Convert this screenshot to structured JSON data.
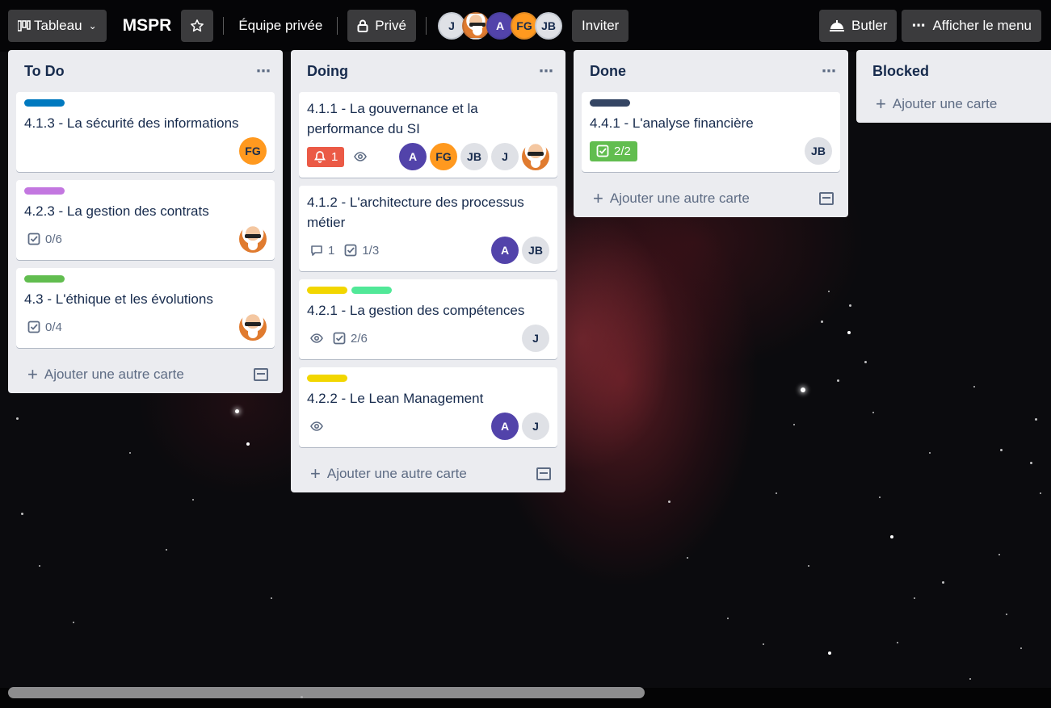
{
  "topbar": {
    "board_switcher": "Tableau",
    "board_title": "MSPR",
    "team": "Équipe privée",
    "visibility": "Privé",
    "members": [
      "J",
      "photo",
      "A",
      "FG",
      "JB"
    ],
    "invite": "Inviter",
    "butler": "Butler",
    "show_menu": "Afficher le menu"
  },
  "lists": [
    {
      "title": "To Do",
      "add_card": "Ajouter une autre carte",
      "cards": [
        {
          "labels": [
            "#0079bf"
          ],
          "title": "4.1.3 - La sécurité des informations",
          "badges": [],
          "members": [
            "FG"
          ]
        },
        {
          "labels": [
            "#c377e0"
          ],
          "title": "4.2.3 - La gestion des contrats",
          "badges": [
            {
              "type": "checklist",
              "text": "0/6"
            }
          ],
          "members": [
            "photo"
          ]
        },
        {
          "labels": [
            "#61bd4f"
          ],
          "title": "4.3 - L'éthique et les évolutions",
          "badges": [
            {
              "type": "checklist",
              "text": "0/4"
            }
          ],
          "members": [
            "photo"
          ]
        }
      ]
    },
    {
      "title": "Doing",
      "add_card": "Ajouter une autre carte",
      "cards": [
        {
          "labels": [],
          "title": "4.1.1 - La gouvernance et la performance du SI",
          "badges": [
            {
              "type": "due",
              "text": "1"
            },
            {
              "type": "watch",
              "text": ""
            }
          ],
          "members": [
            "A",
            "FG",
            "JB",
            "J",
            "photo"
          ]
        },
        {
          "labels": [],
          "title": "4.1.2 - L'architecture des processus métier",
          "badges": [
            {
              "type": "comment",
              "text": "1"
            },
            {
              "type": "checklist",
              "text": "1/3"
            }
          ],
          "members": [
            "A",
            "JB"
          ]
        },
        {
          "labels": [
            "#f2d600",
            "#51e898"
          ],
          "title": "4.2.1 - La gestion des compétences",
          "badges": [
            {
              "type": "watch",
              "text": ""
            },
            {
              "type": "checklist",
              "text": "2/6"
            }
          ],
          "members": [
            "J"
          ]
        },
        {
          "labels": [
            "#f2d600"
          ],
          "title": "4.2.2 - Le Lean Management",
          "badges": [
            {
              "type": "watch",
              "text": ""
            }
          ],
          "members": [
            "A",
            "J"
          ]
        }
      ]
    },
    {
      "title": "Done",
      "add_card": "Ajouter une autre carte",
      "cards": [
        {
          "labels": [
            "#344563"
          ],
          "title": "4.4.1 - L'analyse financière",
          "badges": [
            {
              "type": "checklist-done",
              "text": "2/2"
            }
          ],
          "members": [
            "JB"
          ]
        }
      ]
    },
    {
      "title": "Blocked",
      "add_card": "Ajouter une carte",
      "cards": []
    }
  ]
}
